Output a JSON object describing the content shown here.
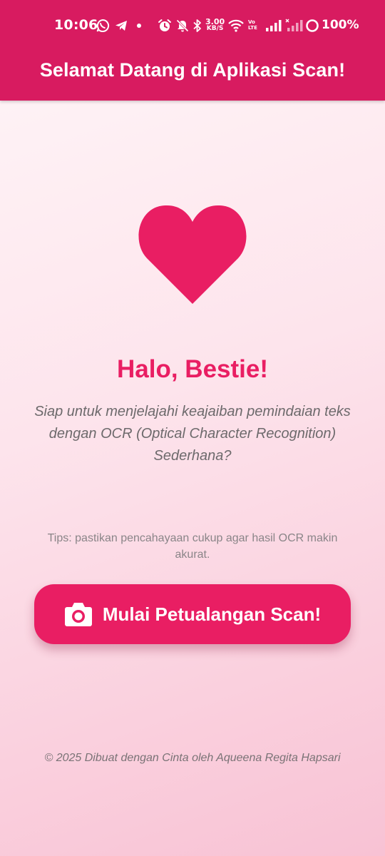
{
  "status_bar": {
    "time": "10:06",
    "network_speed_value": "3.00",
    "network_speed_unit": "KB/S",
    "volte_top": "Vo",
    "volte_bottom": "LTE",
    "battery": "100%",
    "icons": [
      "whatsapp-icon",
      "telegram-icon",
      "dot-icon",
      "alarm-icon",
      "mute-icon",
      "bluetooth-icon",
      "wifi-icon",
      "signal-icon",
      "signal-icon",
      "battery-saver-icon"
    ]
  },
  "app_bar": {
    "title": "Selamat Datang di Aplikasi Scan!"
  },
  "hero": {
    "icon": "heart-icon",
    "greeting": "Halo, Bestie!",
    "subtitle": "Siap untuk menjelajahi keajaiban pemindaian teks dengan OCR (Optical Character Recognition) Sederhana?"
  },
  "tips": "Tips: pastikan pencahayaan cukup agar hasil OCR makin akurat.",
  "scan_button": {
    "icon": "camera-icon",
    "label": "Mulai Petualangan Scan!"
  },
  "footer": "© 2025 Dibuat dengan Cinta oleh Aqueena Regita Hapsari",
  "colors": {
    "app_bar": "#d81b60",
    "accent": "#e91e63",
    "text_muted": "#6d6a6c",
    "background_top": "#fff6f8",
    "background_bottom": "#f8c2d4"
  }
}
